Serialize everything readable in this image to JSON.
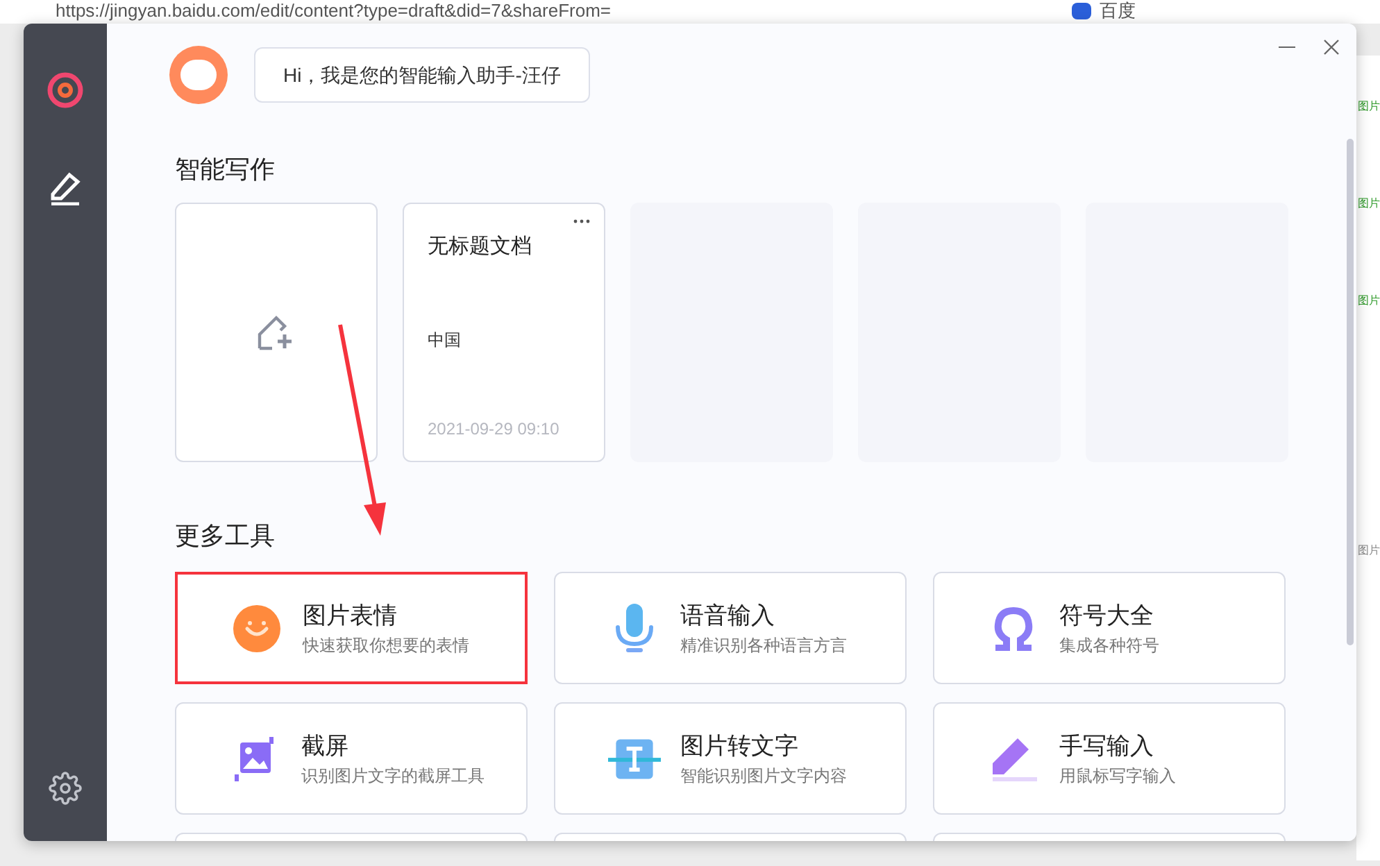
{
  "browser": {
    "url": "https://jingyan.baidu.com/edit/content?type=draft&did=7&shareFrom=",
    "search_engine": "百度"
  },
  "background_page": {
    "side_labels": [
      "图片",
      "图片",
      "图片",
      "图片"
    ]
  },
  "assistant": {
    "greeting": "Hi，我是您的智能输入助手-汪仔"
  },
  "writing": {
    "title": "智能写作",
    "documents": [
      {
        "title": "无标题文档",
        "excerpt": "中国",
        "date": "2021-09-29 09:10"
      }
    ]
  },
  "tools_section": {
    "title": "更多工具",
    "tools": [
      {
        "name": "图片表情",
        "description": "快速获取你想要的表情",
        "highlighted": true
      },
      {
        "name": "语音输入",
        "description": "精准识别各种语言方言",
        "highlighted": false
      },
      {
        "name": "符号大全",
        "description": "集成各种符号",
        "highlighted": false
      },
      {
        "name": "截屏",
        "description": "识别图片文字的截屏工具",
        "highlighted": false
      },
      {
        "name": "图片转文字",
        "description": "智能识别图片文字内容",
        "highlighted": false
      },
      {
        "name": "手写输入",
        "description": "用鼠标写字输入",
        "highlighted": false
      }
    ]
  }
}
